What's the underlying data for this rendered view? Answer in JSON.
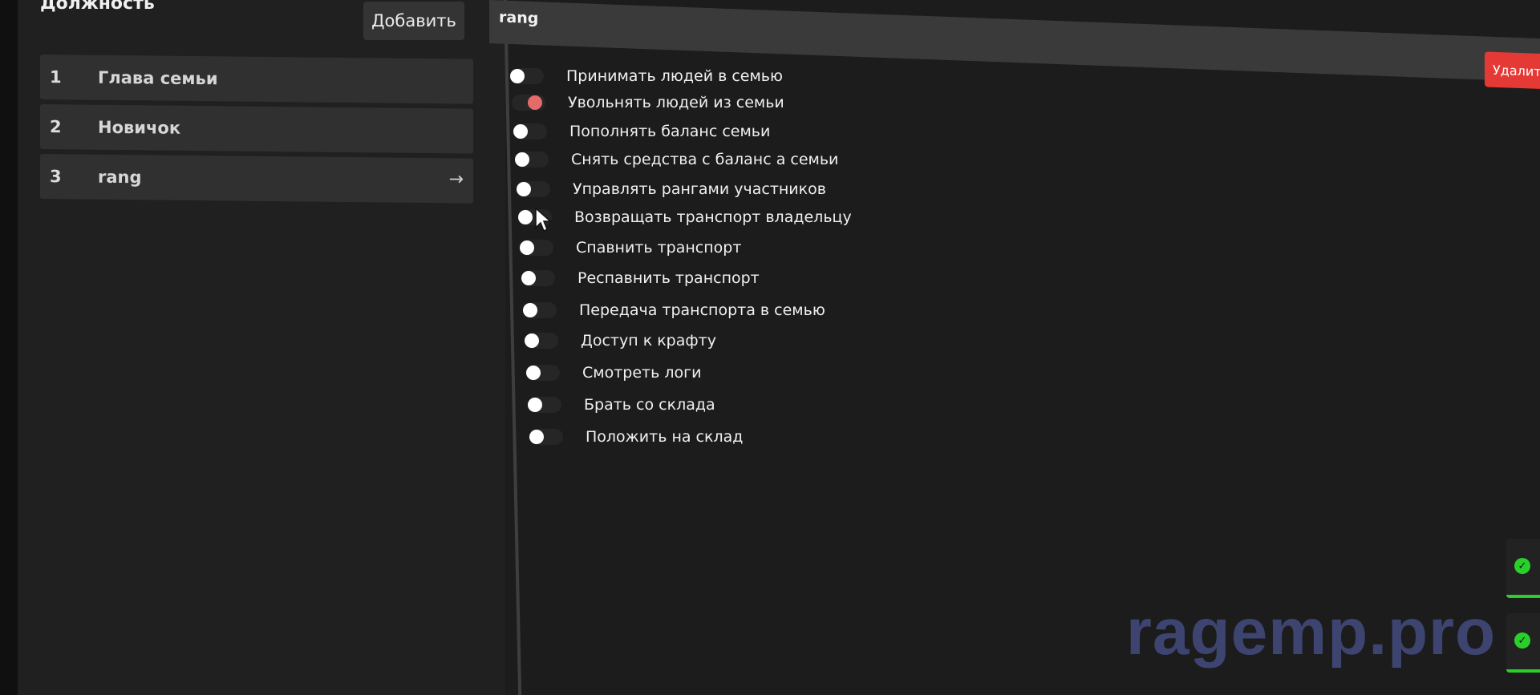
{
  "positions_panel": {
    "title": "Должность",
    "add_label": "Добавить",
    "ranks": [
      {
        "number": "1",
        "name": "Глава семьи"
      },
      {
        "number": "2",
        "name": "Новичок"
      },
      {
        "number": "3",
        "name": "rang",
        "arrow": "→"
      }
    ]
  },
  "rank_panel": {
    "title": "rang",
    "delete_label": "Удалить",
    "permissions": [
      {
        "label": "Принимать людей в семью",
        "enabled": false
      },
      {
        "label": "Увольнять людей из семьи",
        "enabled": true
      },
      {
        "label": "Пополнять баланс семьи",
        "enabled": false
      },
      {
        "label": "Снять средства с баланс а семьи",
        "enabled": false
      },
      {
        "label": "Управлять рангами участников",
        "enabled": false
      },
      {
        "label": "Возвращать транспорт владельцу",
        "enabled": false
      },
      {
        "label": "Спавнить транспорт",
        "enabled": false
      },
      {
        "label": "Респавнить транспорт",
        "enabled": false
      },
      {
        "label": "Передача транспорта в семью",
        "enabled": false
      },
      {
        "label": "Доступ к крафту",
        "enabled": false
      },
      {
        "label": "Смотреть логи",
        "enabled": false
      },
      {
        "label": "Брать со склада",
        "enabled": false
      },
      {
        "label": "Положить на склад",
        "enabled": false
      }
    ]
  },
  "watermark": "ragemp.pro",
  "colors": {
    "toggle_on": "#e56a6a",
    "delete": "#e53935",
    "notification_accent": "#2ad02a",
    "watermark": "#3d4470"
  },
  "icons": {
    "cursor": "mouse-pointer-icon",
    "notification": "check-circle-icon"
  }
}
